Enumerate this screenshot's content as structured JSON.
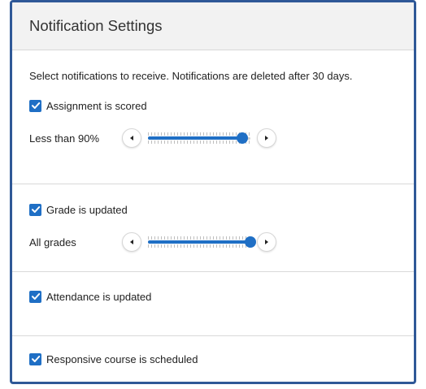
{
  "header": {
    "title": "Notification Settings"
  },
  "intro": "Select notifications to receive. Notifications are deleted after 30 days.",
  "sections": [
    {
      "label": "Assignment is scored",
      "checked": true,
      "slider": {
        "label": "Less than 90%",
        "value_fraction": 0.92
      }
    },
    {
      "label": "Grade is updated",
      "checked": true,
      "slider": {
        "label": "All grades",
        "value_fraction": 1.0
      }
    },
    {
      "label": "Attendance is updated",
      "checked": true
    },
    {
      "label": "Responsive course is scheduled",
      "checked": true
    }
  ],
  "colors": {
    "accent": "#1f6fc5",
    "frame": "#2f5897",
    "header_bg": "#f2f2f2"
  },
  "icons": {
    "checkbox": "check-icon",
    "slider_left": "triangle-left-icon",
    "slider_right": "triangle-right-icon"
  }
}
